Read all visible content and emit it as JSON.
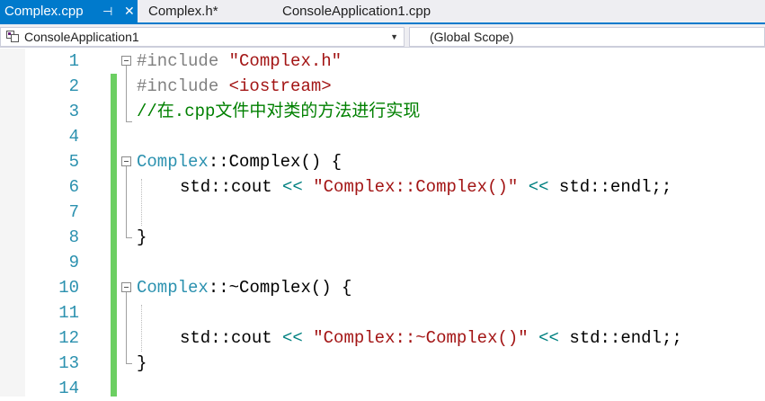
{
  "tabs": [
    {
      "label": "Complex.cpp",
      "active": true,
      "pin_glyph": "⊣",
      "close_glyph": "✕"
    },
    {
      "label": "Complex.h*",
      "active": false
    },
    {
      "label": "ConsoleApplication1.cpp",
      "active": false
    }
  ],
  "navbar": {
    "project": "ConsoleApplication1",
    "scope": "(Global Scope)"
  },
  "line_numbers": [
    "1",
    "2",
    "3",
    "4",
    "5",
    "6",
    "7",
    "8",
    "9",
    "10",
    "11",
    "12",
    "13",
    "14"
  ],
  "code": {
    "l1": {
      "directive": "#include",
      "arg": "\"Complex.h\""
    },
    "l2": {
      "directive": "#include",
      "arg": "<iostream>"
    },
    "l3": {
      "comment": "//在.cpp文件中对类的方法进行实现"
    },
    "l5": {
      "type": "Complex",
      "sep": "::",
      "fn": "Complex() {"
    },
    "l6": {
      "pre": "std::cout ",
      "op": "<<",
      "str": "\"Complex::Complex()\"",
      "op2": "<<",
      "post": " std::endl;;"
    },
    "l8": {
      "text": "}"
    },
    "l10": {
      "type": "Complex",
      "sep": "::",
      "fn": "~Complex() {"
    },
    "l12": {
      "pre": "std::cout ",
      "op": "<<",
      "str": "\"Complex::~Complex()\"",
      "op2": "<<",
      "post": " std::endl;;"
    },
    "l13": {
      "text": "}"
    }
  },
  "colors": {
    "accent": "#007acc",
    "line_number": "#2b91af",
    "change_bar": "#6ccf62",
    "string": "#a31515",
    "comment": "#008000",
    "preprocessor": "#808080"
  }
}
